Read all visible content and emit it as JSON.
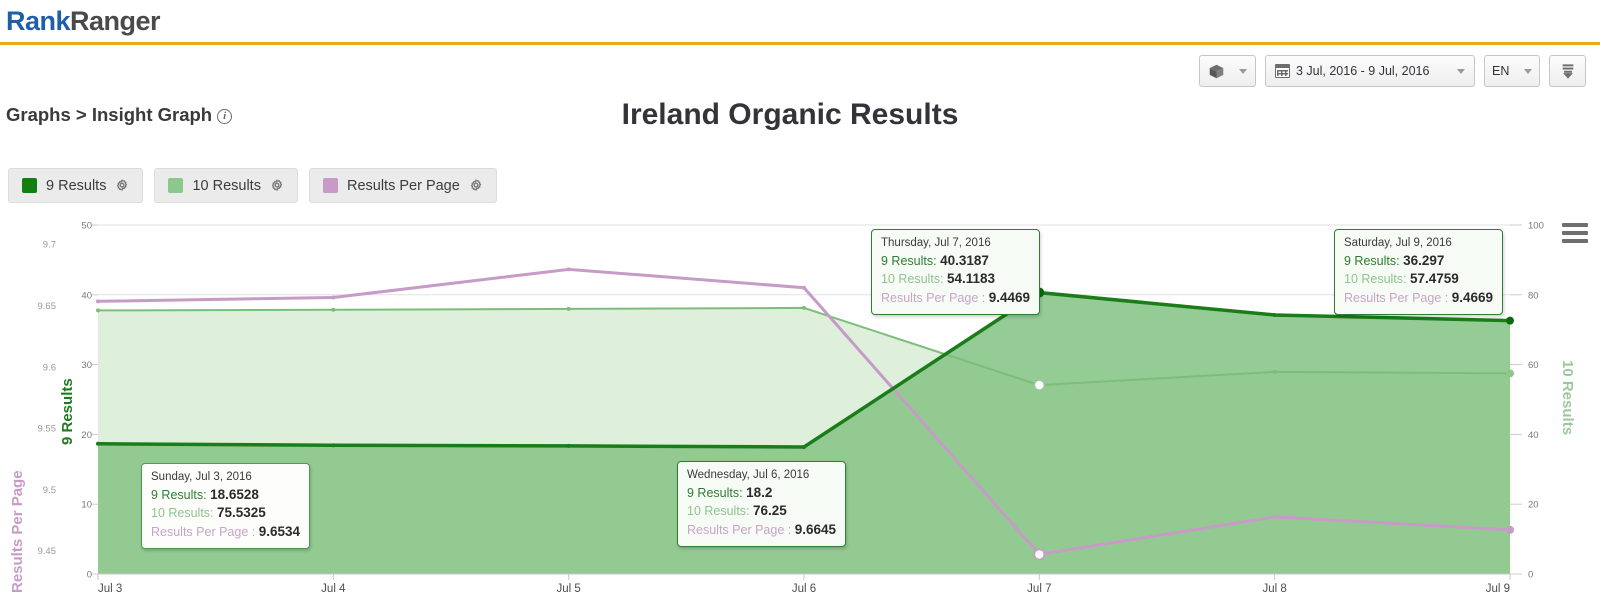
{
  "header": {
    "logo_rank": "Rank",
    "logo_ranger": "Ranger",
    "breadcrumb": "Graphs > Insight Graph",
    "info_icon": "info-icon"
  },
  "toolbar": {
    "cube_icon": "cube-icon",
    "calendar_icon": "calendar-icon",
    "date_range": "3 Jul, 2016 - 9 Jul, 2016",
    "language": "EN",
    "download_icon": "download-icon",
    "caret_icon": "chevron-down-icon"
  },
  "legend": {
    "items": [
      {
        "label": "9 Results",
        "color": "#108010",
        "gear": "gear-icon"
      },
      {
        "label": "10 Results",
        "color": "#8cc78c",
        "gear": "gear-icon"
      },
      {
        "label": "Results Per Page",
        "color": "#c79bc7",
        "gear": "gear-icon"
      }
    ]
  },
  "menu_icon": "hamburger-menu-icon",
  "tooltips": [
    {
      "id": "jul3",
      "date": "Sunday, Jul 3, 2016",
      "k9": "9 Results:",
      "v9": "18.6528",
      "k10": "10 Results:",
      "v10": "75.5325",
      "krpp": "Results Per Page :",
      "vrpp": "9.6534"
    },
    {
      "id": "jul6",
      "date": "Wednesday, Jul 6, 2016",
      "k9": "9 Results:",
      "v9": "18.2",
      "k10": "10 Results:",
      "v10": "76.25",
      "krpp": "Results Per Page :",
      "vrpp": "9.6645"
    },
    {
      "id": "jul7",
      "date": "Thursday, Jul 7, 2016",
      "k9": "9 Results:",
      "v9": "40.3187",
      "k10": "10 Results:",
      "v10": "54.1183",
      "krpp": "Results Per Page :",
      "vrpp": "9.4469"
    },
    {
      "id": "jul9",
      "date": "Saturday, Jul 9, 2016",
      "k9": "9 Results:",
      "v9": "36.297",
      "k10": "10 Results:",
      "v10": "57.4759",
      "krpp": "Results Per Page :",
      "vrpp": "9.4669"
    }
  ],
  "chart_data": {
    "type": "area",
    "title": "Ireland Organic Results",
    "xlabel": "",
    "grid": true,
    "legend_position": "top-left",
    "categories": [
      "Jul 3",
      "Jul 4",
      "Jul 5",
      "Jul 6",
      "Jul 7",
      "Jul 8",
      "Jul 9"
    ],
    "xtick_labels": [
      "Jul 3",
      "Jul 4",
      "Jul 5",
      "Jul 6",
      "Jul 7",
      "Jul 8",
      "Jul 9"
    ],
    "axes": [
      {
        "name": "Results Per Page",
        "side": "left-outer",
        "color": "#c79bc7",
        "ylim": [
          9.4309,
          9.7157
        ],
        "ticks": [
          9.45,
          9.5,
          9.55,
          9.6,
          9.65,
          9.7
        ],
        "tick_labels": [
          "9.45",
          "9.5",
          "9.55",
          "9.6",
          "9.65",
          "9.7"
        ]
      },
      {
        "name": "9 Results",
        "side": "left-inner",
        "color": "#1f7a1f",
        "ylim": [
          0,
          50
        ],
        "ticks": [
          0,
          10,
          20,
          30,
          40,
          50
        ],
        "tick_labels": [
          "0",
          "10",
          "20",
          "30",
          "40",
          "50"
        ]
      },
      {
        "name": "10 Results",
        "side": "right",
        "color": "#8cc78c",
        "ylim": [
          0,
          100
        ],
        "ticks": [
          0,
          20,
          40,
          60,
          80,
          100
        ],
        "tick_labels": [
          "0",
          "20",
          "40",
          "60",
          "80",
          "100"
        ]
      }
    ],
    "series": [
      {
        "name": "9 Results",
        "axis": "9 Results",
        "color": "#1a7d1a",
        "fill": "#8cc78c",
        "values": [
          18.6528,
          18.45,
          18.35,
          18.2,
          40.3187,
          37.1,
          36.297
        ]
      },
      {
        "name": "10 Results",
        "axis": "10 Results",
        "color": "#7cbd7c",
        "fill": "#dcefd9",
        "values": [
          75.5325,
          75.7,
          75.95,
          76.25,
          54.1183,
          57.9,
          57.4759
        ]
      },
      {
        "name": "Results Per Page",
        "axis": "Results Per Page",
        "color": "#c79bc7",
        "fill": "none",
        "values": [
          9.6534,
          9.6565,
          9.6795,
          9.6645,
          9.4469,
          9.4775,
          9.4669
        ]
      }
    ]
  }
}
